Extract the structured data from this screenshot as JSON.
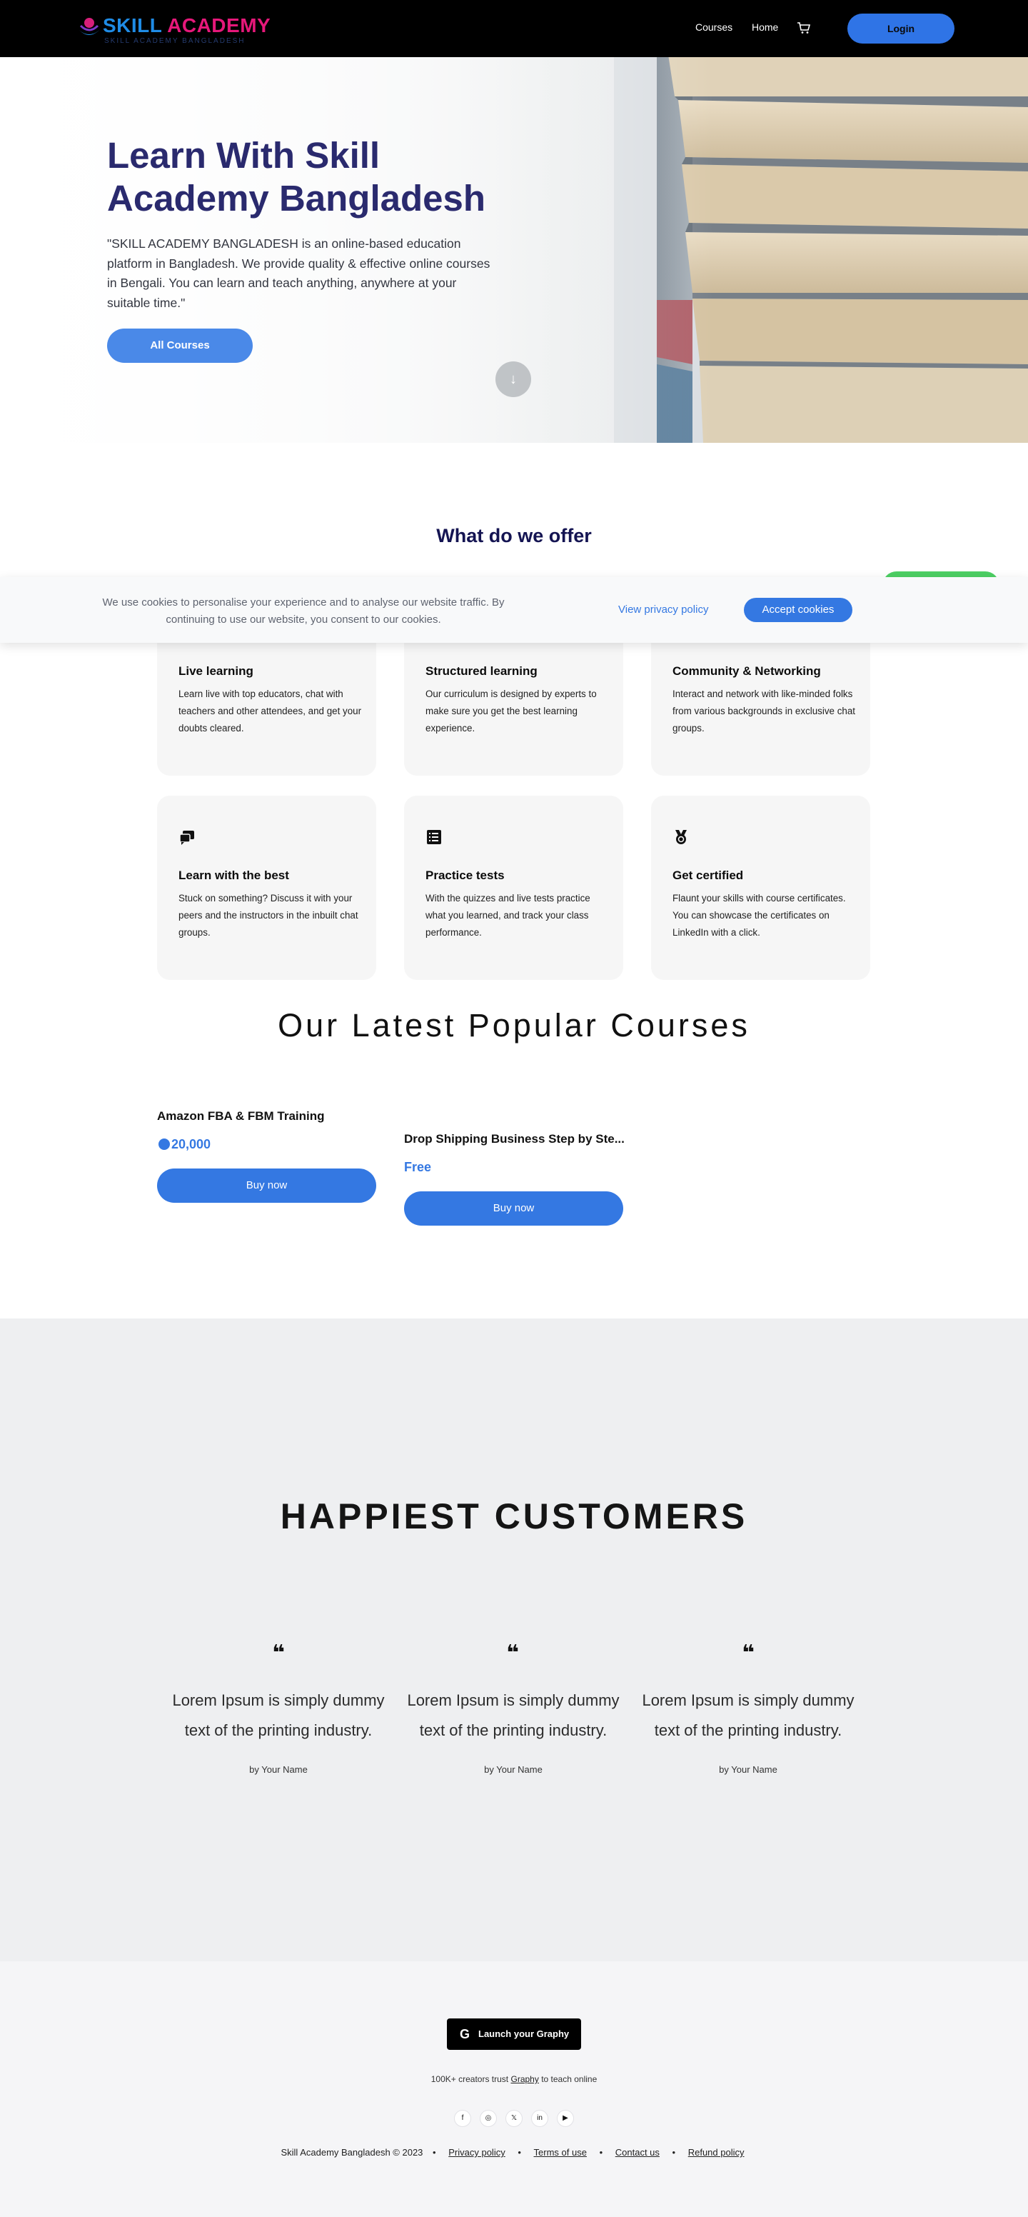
{
  "nav": {
    "logo_text_a": "SKILL",
    "logo_text_b": "ACADEMY",
    "logo_sub": "SKILL ACADEMY BANGLADESH",
    "links": [
      "Courses",
      "Home"
    ],
    "login": "Login"
  },
  "hero": {
    "title": "Learn With Skill Academy Bangladesh",
    "description": "\"SKILL ACADEMY BANGLADESH is an online-based education platform in Bangladesh. We provide quality & effective online courses in Bengali. You can learn and teach anything, anywhere at your suitable time.\"",
    "cta": "All Courses",
    "scroll_icon": "↓"
  },
  "offer": {
    "title": "What do we offer",
    "cards": [
      {
        "icon": "live-icon",
        "title": "Live learning",
        "desc": "Learn live with top educators, chat with teachers and other attendees, and get your doubts cleared."
      },
      {
        "icon": "structured-icon",
        "title": "Structured learning",
        "desc": "Our curriculum is designed by experts to make sure you get the best learning experience."
      },
      {
        "icon": "community-icon",
        "title": "Community & Networking",
        "desc": "Interact and network with like-minded folks from various backgrounds in exclusive chat groups."
      },
      {
        "icon": "chat-icon",
        "title": "Learn with the best",
        "desc": "Stuck on something? Discuss it with your peers and the instructors in the inbuilt chat groups."
      },
      {
        "icon": "list-icon",
        "title": "Practice tests",
        "desc": "With the quizzes and live tests practice what you learned, and track your class performance."
      },
      {
        "icon": "badge-icon",
        "title": "Get certified",
        "desc": "Flaunt your skills with course certificates. You can showcase the certificates on LinkedIn with a click."
      }
    ]
  },
  "cookie": {
    "text": "We use cookies to personalise your experience and to analyse our website traffic. By continuing to use our website, you consent to our cookies.",
    "link": "View privacy policy",
    "accept": "Accept cookies"
  },
  "courses": {
    "title": "Our Latest Popular Courses",
    "items": [
      {
        "title": "Amazon FBA & FBM Training",
        "price": "20,000",
        "buy": "Buy now"
      },
      {
        "title": "Drop Shipping Business Step by Ste...",
        "price": "Free",
        "buy": "Buy now"
      }
    ]
  },
  "testimonials": {
    "title": "HAPPIEST CUSTOMERS",
    "items": [
      {
        "quote": "Lorem Ipsum is simply dummy text of the printing industry.",
        "by": "by Your Name"
      },
      {
        "quote": "Lorem Ipsum is simply dummy text of the printing industry.",
        "by": "by Your Name"
      },
      {
        "quote": "Lorem Ipsum is simply dummy text of the printing industry.",
        "by": "by Your Name"
      }
    ]
  },
  "footer": {
    "launch": "Launch your Graphy",
    "trust_pre": "100K+ creators trust",
    "trust_link": "Graphy",
    "trust_post": "to teach online",
    "social": [
      "f",
      "◎",
      "𝕏",
      "in",
      "▶"
    ],
    "copyright": "Skill Academy Bangladesh © 2023",
    "links": [
      "Privacy policy",
      "Terms of use",
      "Contact us",
      "Refund policy"
    ]
  },
  "colors": {
    "brand": "#3478e2",
    "nav": "#000000",
    "heading": "#2a2a6e"
  }
}
